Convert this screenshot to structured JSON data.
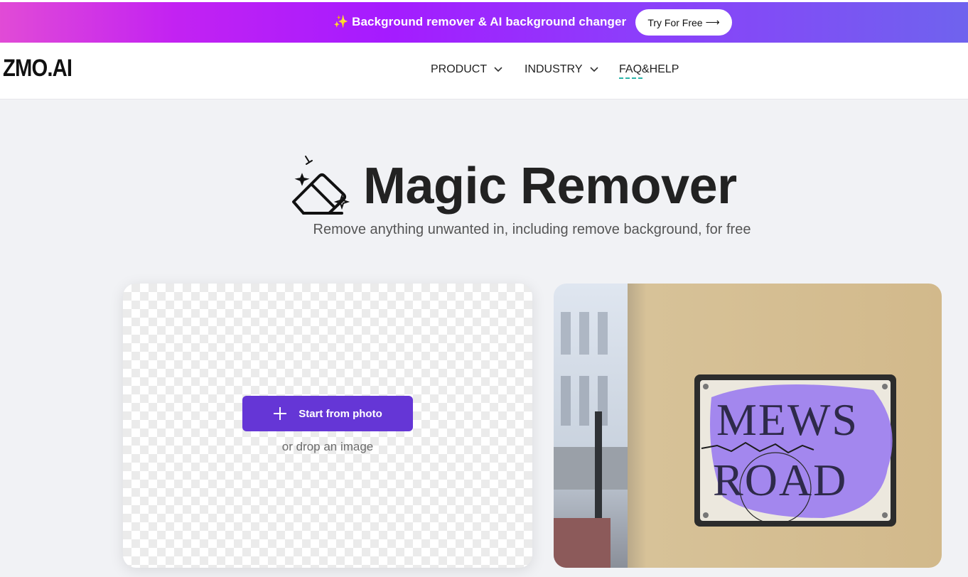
{
  "banner": {
    "sparkle_icon": "✨",
    "text": "Background remover & AI background changer",
    "cta_label": "Try For Free",
    "cta_arrow": "⟶",
    "gradient_colors": [
      "#e14bd6",
      "#a51bff",
      "#6f63ee"
    ]
  },
  "header": {
    "logo": "ZMO.AI",
    "nav": [
      {
        "label": "PRODUCT",
        "has_dropdown": true
      },
      {
        "label": "INDUSTRY",
        "has_dropdown": true
      },
      {
        "label": "FAQ&HELP",
        "has_dropdown": false
      }
    ]
  },
  "hero": {
    "icon": "eraser-sparkle-icon",
    "title": "Magic Remover",
    "subtitle": "Remove anything unwanted in, including remove background, for free"
  },
  "upload": {
    "button_icon": "plus-icon",
    "button_label": "Start from photo",
    "drop_text": "or drop an image",
    "accent_color": "#6536d6"
  },
  "demo": {
    "sign_line1": "MEWS",
    "sign_line2": "ROAD",
    "highlight_color": "#9b7cf0"
  }
}
